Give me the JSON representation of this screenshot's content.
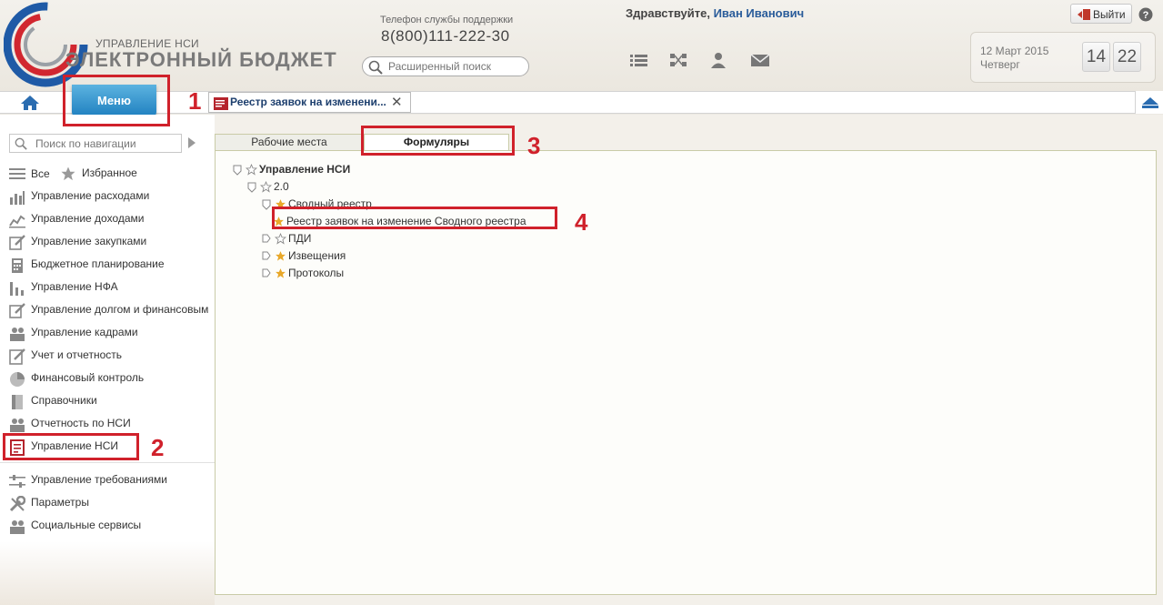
{
  "header": {
    "logo_subtitle": "УПРАВЛЕНИЕ НСИ",
    "logo_title": "ЭЛЕКТРОННЫЙ БЮДЖЕТ",
    "support_label": "Телефон службы поддержки",
    "support_phone": "8(800)111-222-30",
    "search_placeholder": "Расширенный поиск",
    "greeting": "Здравствуйте,",
    "user_name": "Иван Иванович",
    "exit_label": "Выйти",
    "date": "12 Март 2015",
    "weekday": "Четверг",
    "hours": "14",
    "minutes": "22"
  },
  "tabbar": {
    "menu_label": "Меню",
    "open_tab_label": "Реестр заявок на изменени..."
  },
  "sidebar": {
    "search_placeholder": "Поиск по навигации",
    "all_label": "Все",
    "favorites_label": "Избранное",
    "items": [
      {
        "label": "Управление расходами",
        "icon": "chart-bar-icon"
      },
      {
        "label": "Управление доходами",
        "icon": "chart-line-icon"
      },
      {
        "label": "Управление закупками",
        "icon": "edit-icon"
      },
      {
        "label": "Бюджетное планирование",
        "icon": "calculator-icon"
      },
      {
        "label": "Управление НФА",
        "icon": "bars-icon"
      },
      {
        "label": "Управление долгом и финансовым",
        "icon": "edit-icon"
      },
      {
        "label": "Управление кадрами",
        "icon": "people-icon"
      },
      {
        "label": "Учет и отчетность",
        "icon": "pencil-doc-icon"
      },
      {
        "label": "Финансовый контроль",
        "icon": "pie-icon"
      },
      {
        "label": "Справочники",
        "icon": "book-icon"
      },
      {
        "label": "Отчетность по НСИ",
        "icon": "people-icon"
      },
      {
        "label": "Управление НСИ",
        "icon": "register-icon"
      }
    ],
    "bottom_items": [
      {
        "label": "Управление требованиями",
        "icon": "sliders-icon"
      },
      {
        "label": "Параметры",
        "icon": "wrench-icon"
      },
      {
        "label": "Социальные сервисы",
        "icon": "people-icon"
      }
    ]
  },
  "main": {
    "tabs": [
      "Рабочие места",
      "Формуляры"
    ],
    "active_tab": "Формуляры",
    "tree": [
      {
        "label": "Управление НСИ",
        "level": 0,
        "expanded": true,
        "favorite": false
      },
      {
        "label": "2.0",
        "level": 1,
        "expanded": true,
        "favorite": false
      },
      {
        "label": "Сводный реестр",
        "level": 2,
        "expanded": true,
        "favorite": true
      },
      {
        "label": "Реестр заявок на изменение Сводного реестра",
        "level": 3,
        "leaf": true,
        "favorite": true
      },
      {
        "label": "ПДИ",
        "level": 2,
        "expanded": false,
        "favorite": false
      },
      {
        "label": "Извещения",
        "level": 2,
        "expanded": false,
        "favorite": true
      },
      {
        "label": "Протоколы",
        "level": 2,
        "expanded": false,
        "favorite": true
      }
    ]
  },
  "annotations": [
    "1",
    "2",
    "3",
    "4"
  ],
  "colors": {
    "accent": "#1e7fbf",
    "annotation": "#d0212b",
    "star": "#e8a82a"
  }
}
